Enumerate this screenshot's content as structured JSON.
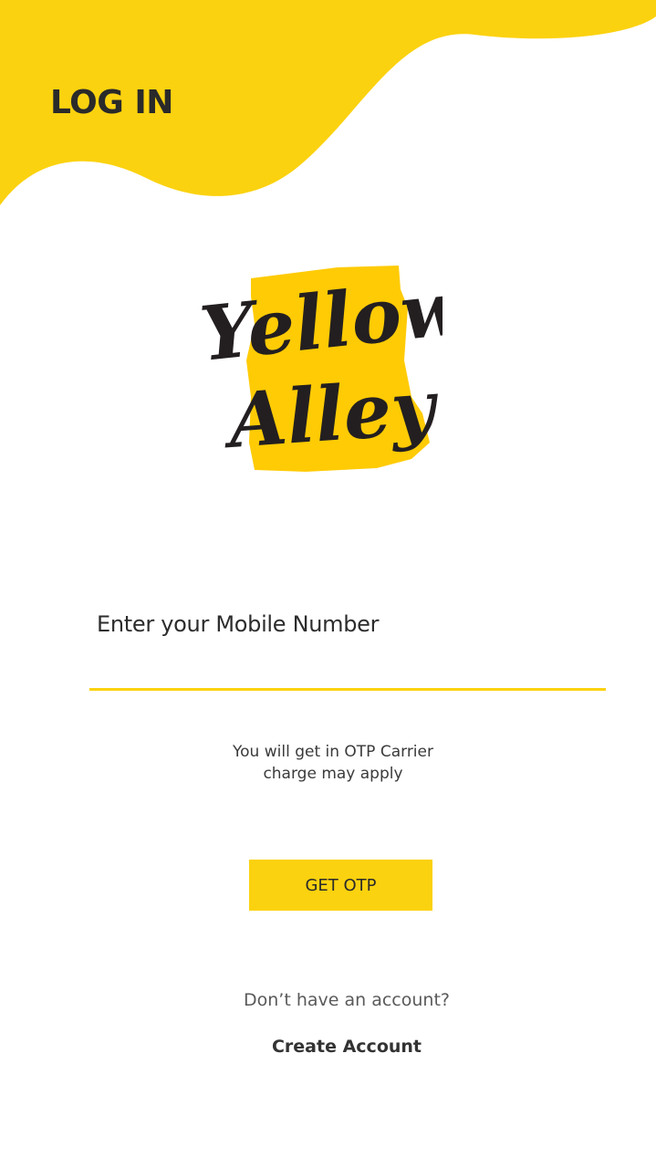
{
  "header": {
    "title": "LOG IN"
  },
  "logo": {
    "line1": "Yellow",
    "line2": "Alley"
  },
  "mobile": {
    "label": "Enter your Mobile Number",
    "value": ""
  },
  "otp_note": {
    "line1": "You will get in OTP Carrier",
    "line2": "charge may apply"
  },
  "buttons": {
    "get_otp": "GET OTP"
  },
  "account": {
    "prompt": "Don’t have an account?",
    "create_link": "Create Account"
  },
  "colors": {
    "accent": "#fbd20f",
    "logo_fill": "#ffcb05",
    "text_dark": "#2a2a2a"
  }
}
